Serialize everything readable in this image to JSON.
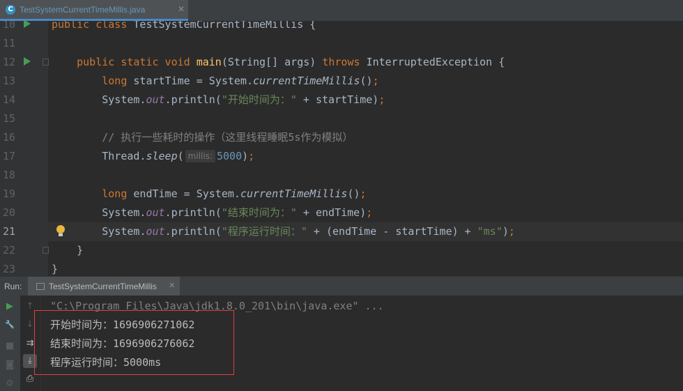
{
  "tab": {
    "file_name": "TestSystemCurrentTimeMillis.java",
    "close_glyph": "✕",
    "icon_letter": "C"
  },
  "editor": {
    "current_line": "21",
    "lines": [
      {
        "num": "10",
        "run": true,
        "fold": false,
        "bulb": false,
        "tokens": [
          {
            "t": "public class ",
            "c": "kw"
          },
          {
            "t": "TestSystemCurrentTimeMillis {",
            "c": ""
          }
        ]
      },
      {
        "num": "11",
        "run": false,
        "fold": false,
        "bulb": false,
        "tokens": []
      },
      {
        "num": "12",
        "run": true,
        "fold": true,
        "bulb": false,
        "tokens": [
          {
            "t": "    public static void ",
            "c": "kw"
          },
          {
            "t": "main",
            "c": "fn"
          },
          {
            "t": "(String[] args) ",
            "c": ""
          },
          {
            "t": "throws ",
            "c": "kw"
          },
          {
            "t": "InterruptedException {",
            "c": ""
          }
        ]
      },
      {
        "num": "13",
        "run": false,
        "fold": false,
        "bulb": false,
        "tokens": [
          {
            "t": "        long ",
            "c": "kw"
          },
          {
            "t": "startTime = System.",
            "c": ""
          },
          {
            "t": "currentTimeMillis",
            "c": "it"
          },
          {
            "t": "()",
            "c": ""
          },
          {
            "t": ";",
            "c": "kw"
          }
        ]
      },
      {
        "num": "14",
        "run": false,
        "fold": false,
        "bulb": false,
        "tokens": [
          {
            "t": "        System.",
            "c": ""
          },
          {
            "t": "out",
            "c": "stat"
          },
          {
            "t": ".println(",
            "c": ""
          },
          {
            "t": "\"开始时间为：\"",
            "c": "str"
          },
          {
            "t": " + startTime)",
            "c": ""
          },
          {
            "t": ";",
            "c": "kw"
          }
        ]
      },
      {
        "num": "15",
        "run": false,
        "fold": false,
        "bulb": false,
        "tokens": []
      },
      {
        "num": "16",
        "run": false,
        "fold": false,
        "bulb": false,
        "tokens": [
          {
            "t": "        // 执行一些耗时的操作（这里线程睡眠5s作为模拟）",
            "c": "cm"
          }
        ]
      },
      {
        "num": "17",
        "run": false,
        "fold": false,
        "bulb": false,
        "tokens": [
          {
            "t": "        Thread.",
            "c": ""
          },
          {
            "t": "sleep",
            "c": "it"
          },
          {
            "t": "(",
            "c": ""
          },
          {
            "t": "millis:",
            "c": "hint"
          },
          {
            "t": "5000",
            "c": "num"
          },
          {
            "t": ")",
            "c": ""
          },
          {
            "t": ";",
            "c": "kw"
          }
        ]
      },
      {
        "num": "18",
        "run": false,
        "fold": false,
        "bulb": false,
        "tokens": []
      },
      {
        "num": "19",
        "run": false,
        "fold": false,
        "bulb": false,
        "tokens": [
          {
            "t": "        long ",
            "c": "kw"
          },
          {
            "t": "endTime = System.",
            "c": ""
          },
          {
            "t": "currentTimeMillis",
            "c": "it"
          },
          {
            "t": "()",
            "c": ""
          },
          {
            "t": ";",
            "c": "kw"
          }
        ]
      },
      {
        "num": "20",
        "run": false,
        "fold": false,
        "bulb": false,
        "tokens": [
          {
            "t": "        System.",
            "c": ""
          },
          {
            "t": "out",
            "c": "stat"
          },
          {
            "t": ".println(",
            "c": ""
          },
          {
            "t": "\"结束时间为：\"",
            "c": "str"
          },
          {
            "t": " + endTime)",
            "c": ""
          },
          {
            "t": ";",
            "c": "kw"
          }
        ]
      },
      {
        "num": "21",
        "run": false,
        "fold": false,
        "bulb": true,
        "tokens": [
          {
            "t": "        System.",
            "c": ""
          },
          {
            "t": "out",
            "c": "stat"
          },
          {
            "t": ".println(",
            "c": ""
          },
          {
            "t": "\"程序运行时间：\"",
            "c": "str"
          },
          {
            "t": " + (endTime - startTime) + ",
            "c": ""
          },
          {
            "t": "\"ms\"",
            "c": "str"
          },
          {
            "t": ")",
            "c": ""
          },
          {
            "t": ";",
            "c": "kw"
          }
        ]
      },
      {
        "num": "22",
        "run": false,
        "fold": true,
        "bulb": false,
        "tokens": [
          {
            "t": "    }",
            "c": ""
          }
        ]
      },
      {
        "num": "23",
        "run": false,
        "fold": false,
        "bulb": false,
        "tokens": [
          {
            "t": "}",
            "c": ""
          }
        ]
      }
    ]
  },
  "run_panel": {
    "label": "Run:",
    "tab_name": "TestSystemCurrentTimeMillis",
    "close_glyph": "✕",
    "console_lines": [
      "\"C:\\Program Files\\Java\\jdk1.8.0_201\\bin\\java.exe\" ...",
      "开始时间为：1696906271062",
      "结束时间为：1696906276062",
      "程序运行时间：5000ms"
    ],
    "tool_icons": {
      "rerun": "▶",
      "settings": "🔧",
      "stop": "■",
      "camera": "◙",
      "gear": "⚙",
      "up": "↑",
      "down": "↓",
      "wrap": "⇉",
      "scroll_end": "⤓",
      "print": "⎙"
    }
  },
  "colors": {
    "highlight": "#e04040",
    "accent": "#4a88c7"
  }
}
